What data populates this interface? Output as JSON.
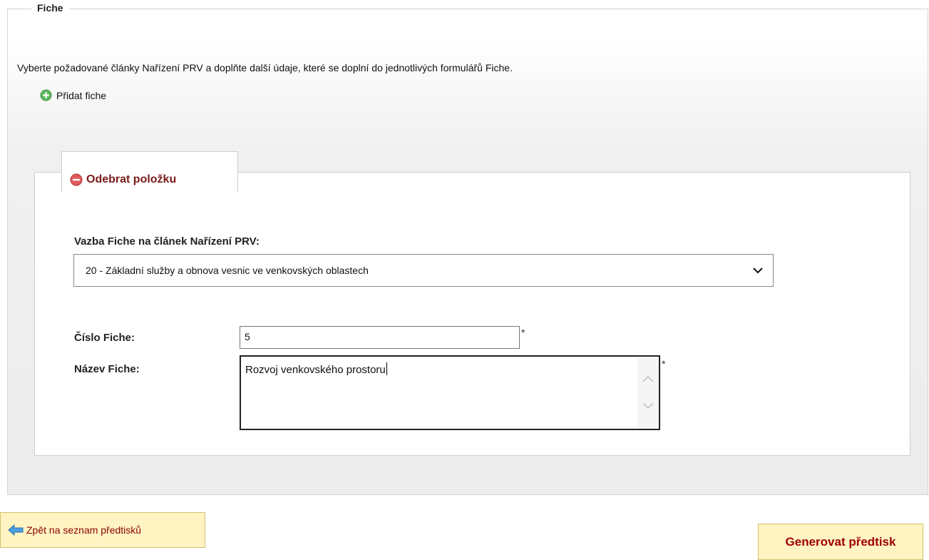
{
  "fieldset": {
    "legend": "Fiche",
    "intro_text": "Vyberte požadované články Nařízení PRV a doplňte další údaje, které se doplní do jednotlivých formulářů Fiche.",
    "add_label": "Přidat fiche"
  },
  "item": {
    "remove_label": "Odebrat položku",
    "vazba_label": "Vazba Fiche na článek Nařízení PRV:",
    "vazba_selected": "20 - Základní služby a obnova vesnic ve venkovských oblastech",
    "cislo_label": "Číslo Fiche:",
    "cislo_value": "5",
    "nazev_label": "Název Fiche:",
    "nazev_value": "Rozvoj venkovského prostoru",
    "required_mark": "*"
  },
  "buttons": {
    "back_label": "Zpět na seznam předtisků",
    "generate_label": "Generovat předtisk"
  },
  "icons": {
    "add": "plus-circle-icon",
    "remove": "minus-circle-icon",
    "back": "arrow-left-icon",
    "select": "chevron-down-icon"
  },
  "colors": {
    "add_icon": "#4caf50",
    "remove_icon": "#e05050",
    "button_bg": "#fff4c2",
    "button_text": "#a00000"
  }
}
